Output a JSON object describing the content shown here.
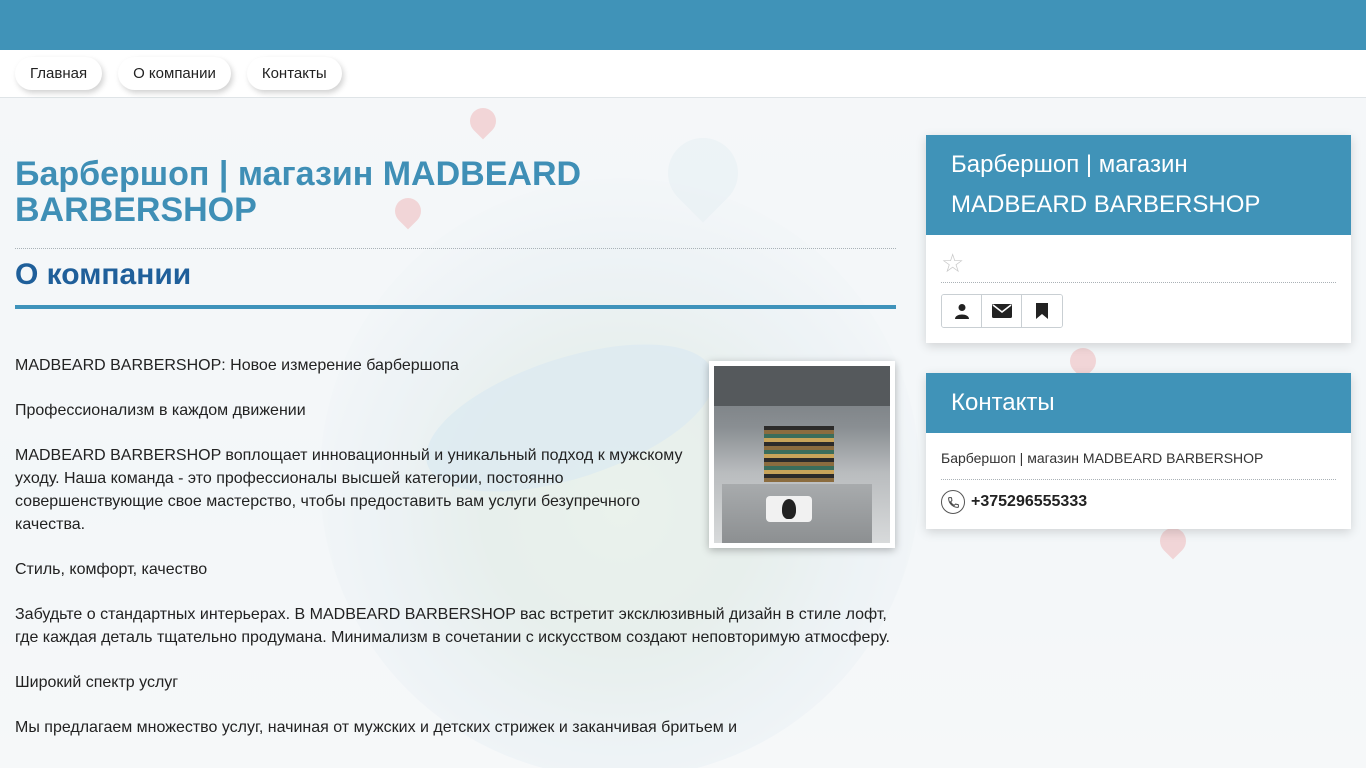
{
  "nav": {
    "items": [
      {
        "label": "Главная"
      },
      {
        "label": "О компании"
      },
      {
        "label": "Контакты"
      }
    ]
  },
  "main": {
    "title": "Барбершоп | магазин MADBEARD BARBERSHOP",
    "section_title": "О компании",
    "paragraphs": [
      "MADBEARD BARBERSHOP: Новое измерение барбершопа",
      "Профессионализм в каждом движении",
      "MADBEARD BARBERSHOP воплощает инновационный и уникальный подход к мужскому уходу. Наша команда - это профессионалы высшей категории, постоянно совершенствующие свое мастерство, чтобы предоставить вам услуги безупречного качества.",
      "Стиль, комфорт, качество",
      "Забудьте о стандартных интерьерах. В MADBEARD BARBERSHOP вас встретит эксклюзивный дизайн в стиле лофт, где каждая деталь тщательно продумана. Минимализм в сочетании с искусством создают неповторимую атмосферу.",
      "Широкий спектр услуг",
      "Мы предлагаем множество услуг, начиная от мужских и детских стрижек и заканчивая бритьем и"
    ]
  },
  "sidebar": {
    "profile_card": {
      "title": "Барбершоп | магазин MADBEARD BARBERSHOP",
      "rating_icon": "star-icon",
      "buttons": [
        {
          "icon": "user-icon"
        },
        {
          "icon": "envelope-icon"
        },
        {
          "icon": "bookmark-icon"
        }
      ]
    },
    "contacts_card": {
      "title": "Контакты",
      "company": "Барбершоп | магазин MADBEARD BARBERSHOP",
      "phone": "+375296555333"
    }
  },
  "colors": {
    "accent": "#4093b8",
    "title": "#3f8fb6",
    "section_title": "#1f5f9a"
  }
}
